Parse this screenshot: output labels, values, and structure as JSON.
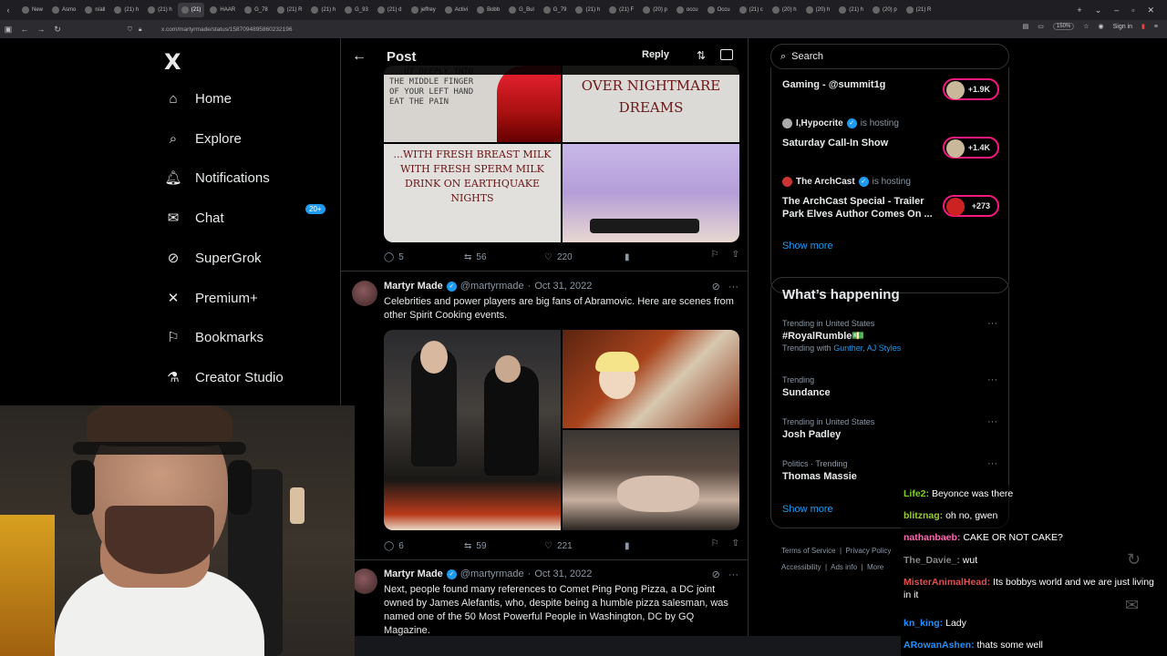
{
  "browser": {
    "tabs": [
      "New",
      "Asmo",
      "n/all",
      "(21) h",
      "(21) h",
      "(21)",
      "HAAR",
      "G_78",
      "(21) R",
      "(21) h",
      "G_93",
      "(21) d",
      "jeffrey",
      "Activi",
      "Bobb",
      "G_Bul",
      "G_79",
      "(21) h",
      "(21) F",
      "(20) p",
      "occu",
      "Occu",
      "(21) c",
      "(20) h",
      "(20) h",
      "(21) h",
      "(20) p",
      "(21) R"
    ],
    "active_tab_index": 5,
    "url": "x.com/martyrmade/status/1587094895860232196",
    "zoom": "150%",
    "sign_in": "Sign in"
  },
  "sidebar": {
    "logo": "X",
    "notifications_badge": "20+",
    "items": [
      {
        "label": "Home",
        "icon": "home-icon"
      },
      {
        "label": "Explore",
        "icon": "search-icon"
      },
      {
        "label": "Notifications",
        "icon": "bell-icon"
      },
      {
        "label": "Chat",
        "icon": "mail-icon"
      },
      {
        "label": "SuperGrok",
        "icon": "grok-icon"
      },
      {
        "label": "Premium+",
        "icon": "x-icon"
      },
      {
        "label": "Bookmarks",
        "icon": "bookmark-icon"
      },
      {
        "label": "Creator Studio",
        "icon": "flask-icon"
      }
    ]
  },
  "header": {
    "title": "Post",
    "reply_label": "Reply"
  },
  "first_tweet": {
    "image_texts": [
      "...UT DEEPLY INTO THE MIDDLE FINGER OF YOUR LEFT HAND EAT THE PAIN",
      "OVER NIGHTMARE DREAMS",
      "...WITH FRESH BREAST MILK WITH FRESH SPERM MILK DRINK ON EARTHQUAKE NIGHTS"
    ],
    "replies": "5",
    "reposts": "56",
    "likes": "220"
  },
  "tweets": [
    {
      "name": "Martyr Made",
      "handle": "@martyrmade",
      "date": "Oct 31, 2022",
      "text": "Celebrities and power players are big fans of Abramovic. Here are scenes from other Spirit Cooking events.",
      "replies": "6",
      "reposts": "59",
      "likes": "221"
    },
    {
      "name": "Martyr Made",
      "handle": "@martyrmade",
      "date": "Oct 31, 2022",
      "text": "Next, people found many references to Comet Ping Pong Pizza, a DC joint owned by James Alefantis, who, despite being a humble pizza salesman, was named one of the 50 Most Powerful People in Washington, DC by GQ Magazine."
    }
  ],
  "right": {
    "search_placeholder": "Search",
    "live": [
      {
        "title": "Gaming - @summit1g",
        "count": "+1.9K"
      },
      {
        "host": "I,Hypocrite",
        "hosting": "is hosting",
        "title": "Saturday Call-In Show",
        "count": "+1.4K"
      },
      {
        "host": "The ArchCast",
        "hosting": "is hosting",
        "title": "The ArchCast Special - Trailer Park Elves Author Comes On ...",
        "count": "+273"
      }
    ],
    "show_more": "Show more",
    "whats_happening": "What’s happening",
    "trends": [
      {
        "context": "Trending in United States",
        "name": "#RoyalRumble💵",
        "with_label": "Trending with",
        "with": "Gunther, AJ Styles"
      },
      {
        "context": "Trending",
        "name": "Sundance"
      },
      {
        "context": "Trending in United States",
        "name": "Josh Padley"
      },
      {
        "context": "Politics · Trending",
        "name": "Thomas Massie"
      }
    ],
    "footer": [
      "Terms of Service",
      "Privacy Policy",
      "Accessibility",
      "Ads info",
      "More"
    ]
  },
  "chat": [
    {
      "user": "Life2:",
      "color": "#7ed321",
      "msg": "Beyonce was there"
    },
    {
      "user": "blitznag:",
      "color": "#9acd32",
      "msg": "oh no, gwen"
    },
    {
      "user": "nathanbaeb:",
      "color": "#ff69b4",
      "msg": "CAKE OR NOT CAKE?"
    },
    {
      "user": "The_Davie_:",
      "color": "#888888",
      "msg": "wut"
    },
    {
      "user": "MisterAnimalHead:",
      "color": "#e05050",
      "msg": "Its bobbys world and we are just living in it"
    },
    {
      "user": "kn_king:",
      "color": "#1e90ff",
      "msg": "Lady"
    },
    {
      "user": "ARowanAshen:",
      "color": "#1e90ff",
      "msg": "thats some well"
    }
  ]
}
